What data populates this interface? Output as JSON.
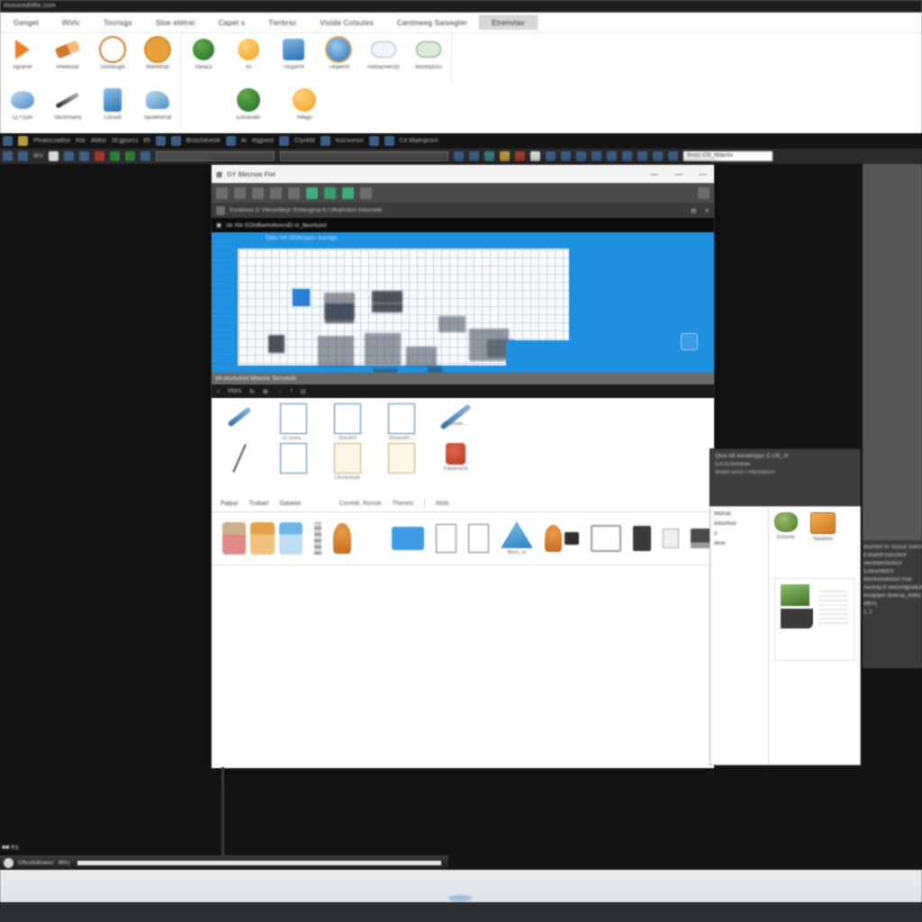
{
  "app": {
    "title_bar": "mvoureditRe.com",
    "window_controls": [
      "minimize",
      "restore",
      "maximize",
      "close"
    ],
    "window_control_glyphs": [
      "—",
      "□",
      "❐",
      "✕"
    ]
  },
  "ribbon": {
    "tabs": [
      {
        "label": "Gеngеt",
        "selected": false
      },
      {
        "label": "iNVic",
        "selected": false
      },
      {
        "label": "Tocrisgs",
        "selected": false
      },
      {
        "label": "Sloe elétrei",
        "selected": false
      },
      {
        "label": "Capеt s",
        "selected": false
      },
      {
        "label": "Tіеrbrsc",
        "selected": false
      },
      {
        "label": "Visida Cotsules",
        "selected": false
      },
      {
        "label": "Cantmeeg Saisegter",
        "selected": false
      },
      {
        "label": "Etrenvtav",
        "selected": true
      }
    ],
    "groups": [
      {
        "items": [
          {
            "label": "Agrarrer",
            "icon": "arrow-triangle-icon"
          },
          {
            "label": "Vreebsfar",
            "icon": "wrench-icon"
          },
          {
            "label": "Tocklesger",
            "icon": "ring-icon"
          },
          {
            "label": "Marfittrop",
            "icon": "ring-filled-icon"
          }
        ]
      },
      {
        "items": [
          {
            "label": "Xdraca",
            "icon": "globe-icon"
          },
          {
            "label": "Irii",
            "icon": "orange-sphere-icon"
          },
          {
            "label": "Tdsperrtr",
            "icon": "device-icon"
          },
          {
            "label": "Tdsperrtl",
            "icon": "blue-sphere-icon"
          },
          {
            "label": "Remannerutz",
            "icon": "cloud-icon"
          },
          {
            "label": "Morerplocs",
            "icon": "cloud-green-icon"
          }
        ]
      },
      {
        "items": [
          {
            "label": "Ly Ftzan",
            "icon": "machine-icon"
          },
          {
            "label": "Vacorroarnj",
            "icon": "pen-icon"
          },
          {
            "label": "Coruoti",
            "icon": "robot-icon"
          },
          {
            "label": "Spolanvrrat",
            "icon": "vehicle-icon"
          }
        ]
      },
      {
        "items": [
          {
            "label": "Extvesder",
            "icon": "green-sphere-icon"
          },
          {
            "label": "Yelligu",
            "icon": "orange-disc-icon"
          }
        ]
      }
    ]
  },
  "menubar": {
    "row1": [
      "Ptvalscvattisr",
      "Kto",
      "AMisi",
      "St:gpurcs",
      "lt5",
      "Brstchitvesti",
      "Ai",
      "ifsgseot",
      "Clynktit",
      "Kocvunso",
      "Cit Mailnprоnl"
    ],
    "row2_placeholder": "",
    "search_value": "Strezt rOIt_Ntdertsr"
  },
  "inner_window": {
    "title": "DY Blecnoe Fixt",
    "controls": [
      "—",
      "—",
      "—"
    ],
    "breadcrumb": "Esrainios 2/ Vlesiedieyt: Etrilesgnar.fс:Ultratnstcn Inlocrawt",
    "path": "ob Xbr EOrdbamobosrsEl ol_ttexntuixz",
    "canvas": {
      "label": "Ebtiv hrt  ODtlssarnr kornfgs",
      "background_color": "#1f8fe0",
      "sheet_color": "#fbfcfd"
    },
    "strip_header": "Wi-eturtutrtni Mtworic  Serndsitir",
    "strip_tools": [
      "⌂",
      "Hors",
      "↻",
      "⊞",
      "→",
      "/",
      "⊟"
    ],
    "doc_rows": [
      [
        {
          "label": "",
          "icon": "pen-tool-icon"
        },
        {
          "label": "uc nnrra...",
          "icon": "document-icon"
        },
        {
          "label": "Orsrdrt:t",
          "icon": "document-copy-icon"
        },
        {
          "label": "Onnesrlt'r...",
          "icon": "document-edit-icon"
        },
        {
          "label": "Srnmste...",
          "icon": "large-pen-icon"
        }
      ],
      [
        {
          "label": "",
          "icon": "line-tool-icon"
        },
        {
          "label": "",
          "icon": "blue-note-icon"
        },
        {
          "label": "t Ernkotontr",
          "icon": "tan-document-icon"
        },
        {
          "label": "",
          "icon": "tan-document2-icon"
        },
        {
          "label": "Patsitnet:tll",
          "icon": "red-stone-icon"
        }
      ]
    ],
    "gallery_tabs": [
      {
        "label": "Paljue"
      },
      {
        "label": "Trobart"
      },
      {
        "label": "Gaseiin"
      }
    ],
    "gallery_subtabs": [
      {
        "label": "Conеdr, Ronoe"
      },
      {
        "label": "Theоes"
      },
      {
        "label": "Ititds"
      }
    ],
    "gallery_items": [
      {
        "icon": "people-group-icon",
        "label": ""
      },
      {
        "icon": "people-group-2-icon",
        "label": ""
      },
      {
        "icon": "people-group-3-icon",
        "label": ""
      },
      {
        "icon": "antenna-rod-icon",
        "label": ""
      },
      {
        "icon": "lamp-icon",
        "label": ""
      },
      {
        "icon": "selected-thumbnail-icon",
        "label": ""
      },
      {
        "icon": "paper-sketch-icon",
        "label": ""
      },
      {
        "icon": "paper-sketch-2-icon",
        "label": ""
      },
      {
        "icon": "tent-icon",
        "label": "Btem_ut"
      },
      {
        "icon": "lamp-2-icon",
        "label": ""
      },
      {
        "icon": "dark-block-icon",
        "label": ""
      },
      {
        "icon": "monitor-icon",
        "label": ""
      },
      {
        "icon": "book-icon",
        "label": ""
      },
      {
        "icon": "laptop-icon",
        "label": ""
      }
    ]
  },
  "float_panel_top": {
    "title": "Qtox tdl esvatirtpyc C-Ult_:rt",
    "line1": "lEfCfCtombtae",
    "line2": "dhotct sionz f mtestbetcn"
  },
  "float_panel_main": {
    "nav": [
      "Mtdsat:",
      "Iottorthov",
      "č:",
      "dkov"
    ],
    "swatches": [
      {
        "label": "Entstote",
        "color": "#6d9a43"
      },
      {
        "label": "Tatsdetor",
        "color": "#d1761d"
      }
    ]
  },
  "right_list": {
    "lines": [
      "Itsontes ro- toosur ostruSbtP",
      "b.Blatritt'cotscbror",
      "vernbtbonsotscr",
      "Esteorrtbfii'tr",
      "bfoHnoXdtstoct Puit",
      "Aestotp,tt netcrmtjpstllOtc",
      "evutptjert tttotnsp_tfdtttz",
      "IttftXc",
      "1,:z"
    ]
  },
  "taskbar": {
    "tray_text": "■■ Ks",
    "task_text": "Cftvutcttnaoc/",
    "task_badge": "IftXc"
  },
  "colors": {
    "desktop": "#141414",
    "accent_blue": "#1f8fe0",
    "ribbon_bg": "#fdfdfd",
    "darkbar": "#141414",
    "gray_panel": "#565656",
    "orange": "#d2762a",
    "green": "#2f7d3a"
  }
}
